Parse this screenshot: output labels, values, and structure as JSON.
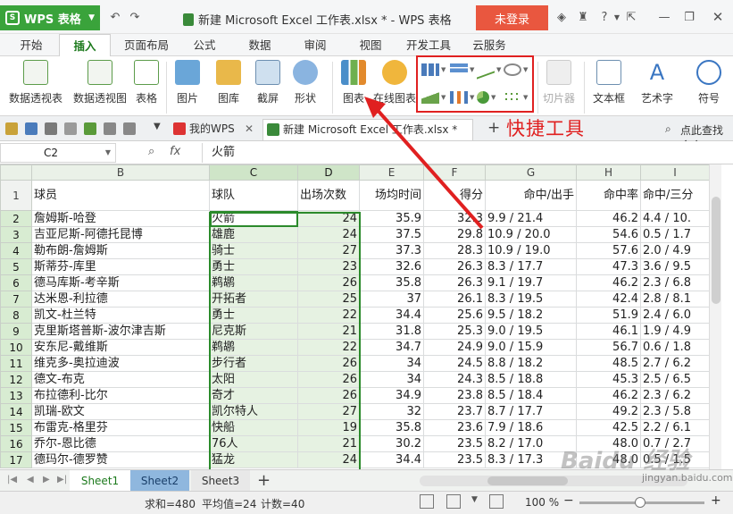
{
  "titlebar": {
    "app_name": "WPS 表格",
    "doc_title": "新建 Microsoft Excel 工作表.xlsx * - WPS 表格",
    "login": "未登录"
  },
  "ribbon_tabs": [
    "开始",
    "插入",
    "页面布局",
    "公式",
    "数据",
    "审阅",
    "视图",
    "开发工具",
    "云服务"
  ],
  "active_tab": "插入",
  "ribbon": {
    "pivot_table": "数据透视表",
    "pivot_chart": "数据透视图",
    "table": "表格",
    "picture": "图片",
    "gallery": "图库",
    "screenshot": "截屏",
    "shape": "形状",
    "chart": "图表",
    "online_chart": "在线图表",
    "slicer": "切片器",
    "textbox": "文本框",
    "wordart": "艺术字",
    "symbol": "符号"
  },
  "doc_tabs": {
    "my_wps": "我的WPS",
    "workbook": "新建 Microsoft Excel 工作表.xlsx *",
    "search": "点此查找命令"
  },
  "formula_bar": {
    "cell_ref": "C2",
    "fx": "fx",
    "value": "火箭"
  },
  "columns": [
    "B",
    "C",
    "D",
    "E",
    "F",
    "G",
    "H",
    "I"
  ],
  "header_row": [
    "球员",
    "球队",
    "出场次数",
    "场均时间",
    "得分",
    "命中/出手",
    "命中率",
    "命中/三分"
  ],
  "rows": [
    [
      "2",
      "詹姆斯-哈登",
      "火箭",
      "24",
      "35.9",
      "32.3",
      "9.9 / 21.4",
      "46.2",
      "4.4 / 10."
    ],
    [
      "3",
      "吉亚尼斯-阿德托昆博",
      "雄鹿",
      "24",
      "37.5",
      "29.8",
      "10.9 / 20.0",
      "54.6",
      "0.5 / 1.7"
    ],
    [
      "4",
      "勒布朗-詹姆斯",
      "骑士",
      "27",
      "37.3",
      "28.3",
      "10.9 / 19.0",
      "57.6",
      "2.0 / 4.9"
    ],
    [
      "5",
      "斯蒂芬-库里",
      "勇士",
      "23",
      "32.6",
      "26.3",
      "8.3 / 17.7",
      "47.3",
      "3.6 / 9.5"
    ],
    [
      "6",
      "德马库斯-考辛斯",
      "鹈鹕",
      "26",
      "35.8",
      "26.3",
      "9.1 / 19.7",
      "46.2",
      "2.3 / 6.8"
    ],
    [
      "7",
      "达米恩-利拉德",
      "开拓者",
      "25",
      "37",
      "26.1",
      "8.3 / 19.5",
      "42.4",
      "2.8 / 8.1"
    ],
    [
      "8",
      "凯文-杜兰特",
      "勇士",
      "22",
      "34.4",
      "25.6",
      "9.5 / 18.2",
      "51.9",
      "2.4 / 6.0"
    ],
    [
      "9",
      "克里斯塔普斯-波尔津吉斯",
      "尼克斯",
      "21",
      "31.8",
      "25.3",
      "9.0 / 19.5",
      "46.1",
      "1.9 / 4.9"
    ],
    [
      "10",
      "安东尼-戴维斯",
      "鹈鹕",
      "22",
      "34.7",
      "24.9",
      "9.0 / 15.9",
      "56.7",
      "0.6 / 1.8"
    ],
    [
      "11",
      "维克多-奥拉迪波",
      "步行者",
      "26",
      "34",
      "24.5",
      "8.8 / 18.2",
      "48.5",
      "2.7 / 6.2"
    ],
    [
      "12",
      "德文-布克",
      "太阳",
      "26",
      "34",
      "24.3",
      "8.5 / 18.8",
      "45.3",
      "2.5 / 6.5"
    ],
    [
      "13",
      "布拉德利-比尔",
      "奇才",
      "26",
      "34.9",
      "23.8",
      "8.5 / 18.4",
      "46.2",
      "2.3 / 6.2"
    ],
    [
      "14",
      "凯瑞-欧文",
      "凯尔特人",
      "27",
      "32",
      "23.7",
      "8.7 / 17.7",
      "49.2",
      "2.3 / 5.8"
    ],
    [
      "15",
      "布雷克-格里芬",
      "快船",
      "19",
      "35.8",
      "23.6",
      "7.9 / 18.6",
      "42.5",
      "2.2 / 6.1"
    ],
    [
      "16",
      "乔尔-恩比德",
      "76人",
      "21",
      "30.2",
      "23.5",
      "8.2 / 17.0",
      "48.0",
      "0.7 / 2.7"
    ],
    [
      "17",
      "德玛尔-德罗赞",
      "猛龙",
      "24",
      "34.4",
      "23.5",
      "8.3 / 17.3",
      "48.0",
      "0.5 / 1.5"
    ]
  ],
  "sheets": [
    "Sheet1",
    "Sheet2",
    "Sheet3"
  ],
  "status": {
    "sum": "求和=480",
    "avg": "平均值=24",
    "count": "计数=40",
    "zoom": "100 %"
  },
  "annotation": "快捷工具",
  "watermark": "Baidu 经验",
  "watermark_url": "jingyan.baidu.com",
  "colors": {
    "accent": "#3aa33b",
    "login": "#e9573f",
    "annotation": "#e02020"
  }
}
